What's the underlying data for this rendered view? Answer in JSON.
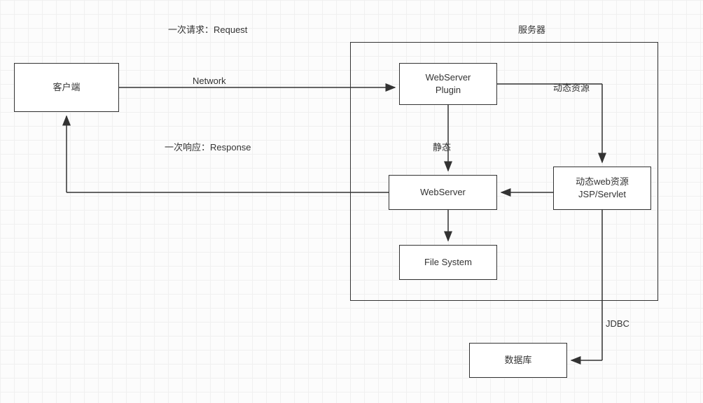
{
  "nodes": {
    "client": "客户端",
    "server_title": "服务器",
    "webserver_plugin": "WebServer\nPlugin",
    "webserver": "WebServer",
    "file_system": "File System",
    "dynamic_resource": "动态web资源\nJSP/Servlet",
    "database": "数据库"
  },
  "edges": {
    "request": "一次请求：Request",
    "response": "一次响应：Response",
    "network": "Network",
    "dynamic": "动态资源",
    "static": "静态",
    "jdbc": "JDBC"
  }
}
